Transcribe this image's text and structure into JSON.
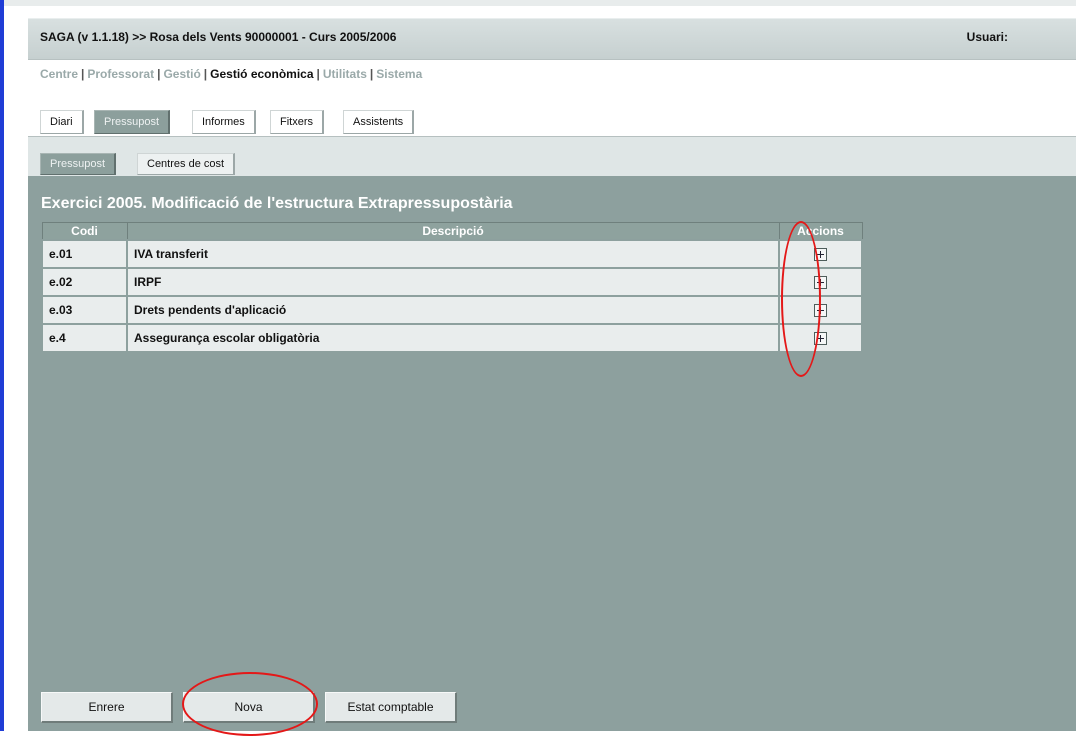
{
  "app": {
    "title": "SAGA (v 1.1.18) >> Rosa dels Vents 90000001 - Curs 2005/2006",
    "user_label": "Usuari:"
  },
  "menu": {
    "items": [
      {
        "label": "Centre",
        "active": false
      },
      {
        "label": "Professorat",
        "active": false
      },
      {
        "label": "Gestió",
        "active": false
      },
      {
        "label": "Gestió econòmica",
        "active": true
      },
      {
        "label": "Utilitats",
        "active": false
      },
      {
        "label": "Sistema",
        "active": false
      }
    ],
    "separator": "|"
  },
  "tabs": [
    {
      "label": "Diari",
      "selected": false
    },
    {
      "label": "Pressupost",
      "selected": true
    },
    {
      "label": "Informes",
      "selected": false
    },
    {
      "label": "Fitxers",
      "selected": false
    },
    {
      "label": "Assistents",
      "selected": false
    }
  ],
  "subtabs": [
    {
      "label": "Pressupost",
      "selected": true
    },
    {
      "label": "Centres de cost",
      "selected": false
    }
  ],
  "page": {
    "heading": "Exercici 2005. Modificació de l'estructura Extrapressupostària"
  },
  "table": {
    "headers": {
      "code": "Codi",
      "description": "Descripció",
      "actions": "Accions"
    },
    "rows": [
      {
        "code": "e.01",
        "description": "IVA transferit"
      },
      {
        "code": "e.02",
        "description": "IRPF"
      },
      {
        "code": "e.03",
        "description": "Drets pendents d'aplicació"
      },
      {
        "code": "e.4",
        "description": "Assegurança escolar obligatòria"
      }
    ]
  },
  "buttons": {
    "back": "Enrere",
    "new": "Nova",
    "accounting_status": "Estat comptable"
  },
  "icons": {
    "row_action": "add-icon"
  },
  "colors": {
    "content_bg": "#8da09e",
    "annotation": "#e41818"
  }
}
